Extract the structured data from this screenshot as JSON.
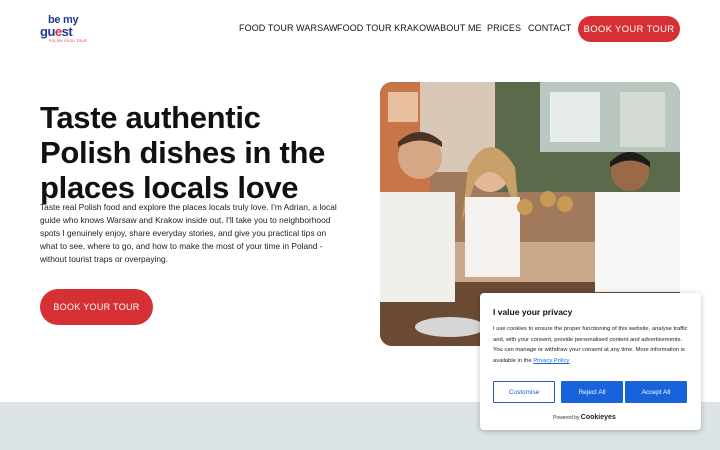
{
  "header": {
    "logo": {
      "line1": "be my",
      "line2_a": "gu",
      "line2_b": "e",
      "line2_c": "st",
      "tagline": "POLISH FOOD TOUR"
    },
    "nav": [
      {
        "label": "FOOD TOUR WARSAW"
      },
      {
        "label": "FOOD TOUR KRAKOW"
      },
      {
        "label": "ABOUT ME"
      },
      {
        "label": "PRICES"
      },
      {
        "label": "CONTACT"
      }
    ],
    "cta_label": "BOOK YOUR TOUR"
  },
  "hero": {
    "title": "Taste authentic Polish dishes in the places locals love",
    "text": "Taste real Polish food and explore the places locals truly love. I'm Adrian, a local guide who knows Warsaw and Krakow inside out. I'll take you to neighborhood spots I genuinely enjoy, share everyday stories, and give you practical tips on what to see, where to go, and how to make the most of your time in Poland - without tourist traps or overpaying.",
    "cta_label": "BOOK YOUR TOUR"
  },
  "cookie": {
    "title": "I value your privacy",
    "text": "I use cookies to ensure the proper functioning of this website, analyse traffic and, with your consent, provide personalised content and advertisements. You can manage or withdraw your consent at any time. More information is available in the",
    "link": "Privacy Policy",
    "customise": "Customise",
    "reject": "Reject All",
    "accept": "Accept All",
    "powered_by": "Powered by",
    "brand": "Cookieyes"
  },
  "colors": {
    "accent": "#d62f34",
    "brand_blue": "#1f3a93",
    "cookie_blue": "#1863dc",
    "band": "#dbe3e6"
  }
}
